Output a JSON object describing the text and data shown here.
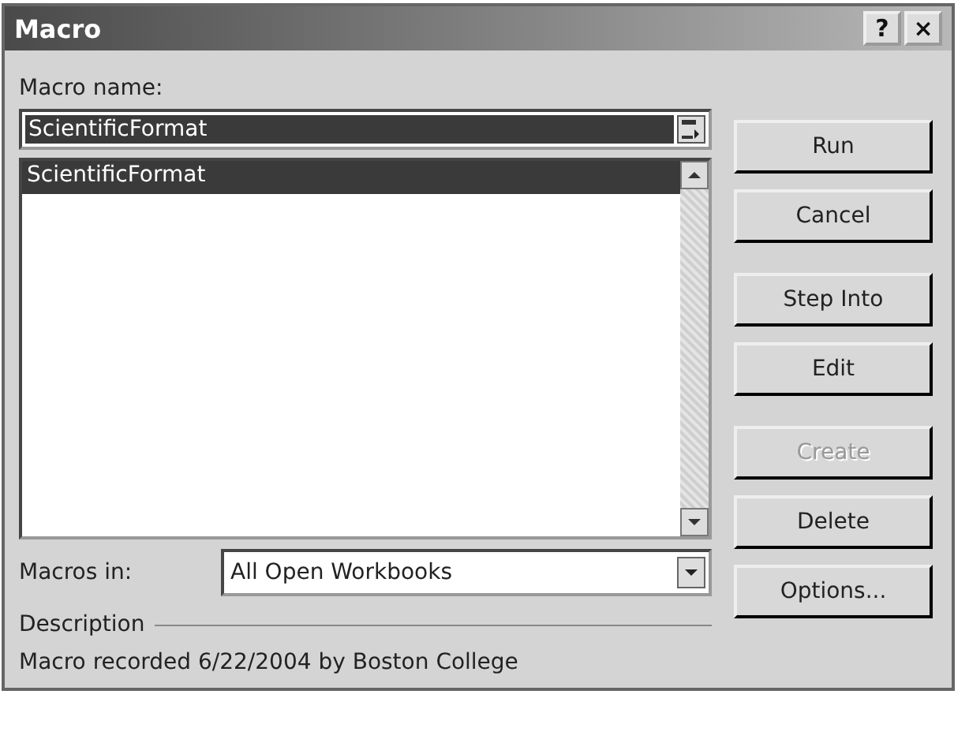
{
  "window": {
    "title": "Macro",
    "help_button": "?",
    "close_button": "×"
  },
  "macro_name": {
    "label": "Macro name:",
    "value": "ScientificFormat"
  },
  "macro_list": {
    "items": [
      {
        "label": "ScientificFormat",
        "selected": true
      }
    ]
  },
  "macros_in": {
    "label": "Macros in:",
    "value": "All Open Workbooks"
  },
  "description": {
    "label": "Description",
    "text": "Macro recorded 6/22/2004 by Boston College"
  },
  "buttons": [
    {
      "label": "Run",
      "disabled": false
    },
    {
      "label": "Cancel",
      "disabled": false
    },
    {
      "label": "Step Into",
      "disabled": false
    },
    {
      "label": "Edit",
      "disabled": false
    },
    {
      "label": "Create",
      "disabled": true
    },
    {
      "label": "Delete",
      "disabled": false
    },
    {
      "label": "Options...",
      "disabled": false
    }
  ]
}
